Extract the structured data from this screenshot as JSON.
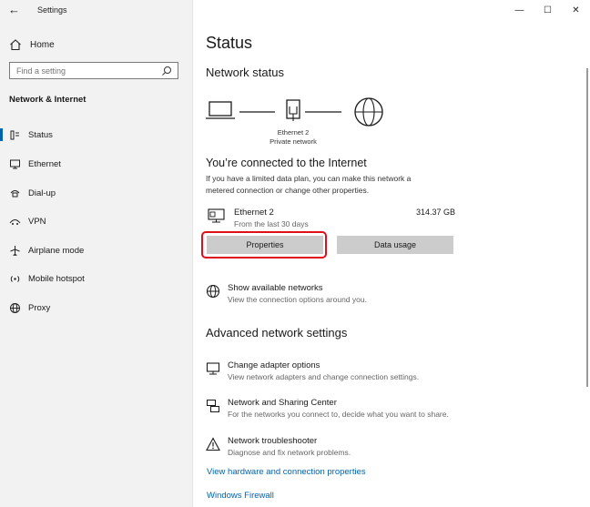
{
  "window": {
    "app_title": "Settings",
    "controls": {
      "minimize": "—",
      "maximize": "☐",
      "close": "✕"
    }
  },
  "sidebar": {
    "home_label": "Home",
    "search_placeholder": "Find a setting",
    "section_label": "Network & Internet",
    "items": [
      {
        "label": "Status",
        "icon": "status-icon",
        "active": true
      },
      {
        "label": "Ethernet",
        "icon": "ethernet-icon"
      },
      {
        "label": "Dial-up",
        "icon": "dialup-icon"
      },
      {
        "label": "VPN",
        "icon": "vpn-icon"
      },
      {
        "label": "Airplane mode",
        "icon": "airplane-icon"
      },
      {
        "label": "Mobile hotspot",
        "icon": "hotspot-icon"
      },
      {
        "label": "Proxy",
        "icon": "globe-icon"
      }
    ]
  },
  "main": {
    "title": "Status",
    "network_status_heading": "Network status",
    "diagram": {
      "adapter_name": "Ethernet 2",
      "network_type": "Private network"
    },
    "connected_heading": "You’re connected to the Internet",
    "connected_desc_line1": "If you have a limited data plan, you can make this network a",
    "connected_desc_line2": "metered connection or change other properties.",
    "usage": {
      "name": "Ethernet 2",
      "period": "From the last 30 days",
      "amount": "314.37 GB"
    },
    "buttons": {
      "properties": "Properties",
      "data_usage": "Data usage"
    },
    "show_networks": {
      "title": "Show available networks",
      "desc": "View the connection options around you."
    },
    "advanced_heading": "Advanced network settings",
    "advanced_items": [
      {
        "title": "Change adapter options",
        "desc": "View network adapters and change connection settings.",
        "icon": "adapter-icon"
      },
      {
        "title": "Network and Sharing Center",
        "desc": "For the networks you connect to, decide what you want to share.",
        "icon": "sharing-icon"
      },
      {
        "title": "Network troubleshooter",
        "desc": "Diagnose and fix network problems.",
        "icon": "warning-icon"
      }
    ],
    "links": {
      "hardware_properties": "View hardware and connection properties",
      "windows_firewall": "Windows Firewall"
    }
  },
  "colors": {
    "accent": "#0063b1",
    "highlight": "#e0101b",
    "sidebar_bg": "#f2f2f2",
    "button_bg": "#cccccc"
  }
}
